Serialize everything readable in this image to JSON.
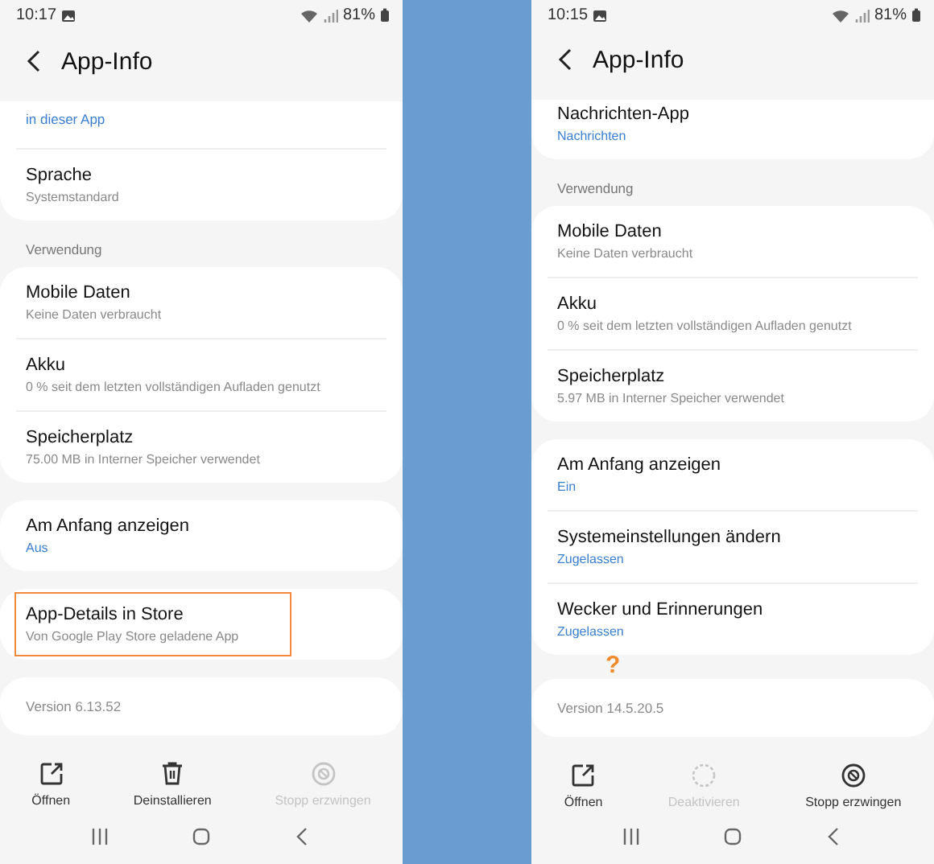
{
  "phones": [
    {
      "status_bar": {
        "time": "10:17",
        "battery": "81%"
      },
      "title": "App-Info",
      "sections": [
        {
          "kind": "card",
          "highlighted": false,
          "cut": true,
          "rows": [
            {
              "subtitle": "in dieser App",
              "accent": true
            },
            {
              "title": "Sprache",
              "subtitle": "Systemstandard",
              "accent": false
            }
          ]
        },
        {
          "kind": "heading",
          "text": "Verwendung"
        },
        {
          "kind": "card",
          "highlighted": false,
          "rows": [
            {
              "title": "Mobile Daten",
              "subtitle": "Keine Daten verbraucht",
              "accent": false
            },
            {
              "title": "Akku",
              "subtitle": "0 % seit dem letzten vollständigen Aufladen genutzt",
              "accent": false
            },
            {
              "title": "Speicherplatz",
              "subtitle": "75.00 MB in Interner Speicher verwendet",
              "accent": false
            }
          ]
        },
        {
          "kind": "card",
          "highlighted": false,
          "rows": [
            {
              "title": "Am Anfang anzeigen",
              "subtitle": "Aus",
              "accent": true
            }
          ]
        },
        {
          "kind": "card",
          "highlighted": true,
          "rows": [
            {
              "title": "App-Details in Store",
              "subtitle": "Von Google Play Store geladene App",
              "accent": false
            }
          ]
        },
        {
          "kind": "card",
          "highlighted": false,
          "rows": [
            {
              "subtitle": "Version 6.13.52",
              "accent": false
            }
          ]
        }
      ],
      "actions": [
        {
          "label": "Öffnen",
          "kind": "open",
          "disabled": false
        },
        {
          "label": "Deinstallieren",
          "kind": "trash",
          "disabled": false
        },
        {
          "label": "Stopp erzwingen",
          "kind": "stop",
          "disabled": true
        }
      ]
    },
    {
      "status_bar": {
        "time": "10:15",
        "battery": "81%"
      },
      "title": "App-Info",
      "sections": [
        {
          "kind": "card",
          "highlighted": false,
          "cut": true,
          "rows": [
            {
              "title": "Nachrichten-App",
              "subtitle": "Nachrichten",
              "accent": true
            }
          ]
        },
        {
          "kind": "heading",
          "text": "Verwendung"
        },
        {
          "kind": "card",
          "highlighted": false,
          "rows": [
            {
              "title": "Mobile Daten",
              "subtitle": "Keine Daten verbraucht",
              "accent": false
            },
            {
              "title": "Akku",
              "subtitle": "0 % seit dem letzten vollständigen Aufladen genutzt",
              "accent": false
            },
            {
              "title": "Speicherplatz",
              "subtitle": "5.97 MB in Interner Speicher verwendet",
              "accent": false
            }
          ]
        },
        {
          "kind": "card",
          "highlighted": false,
          "rows": [
            {
              "title": "Am Anfang anzeigen",
              "subtitle": "Ein",
              "accent": true
            },
            {
              "title": "Systemeinstellungen ändern",
              "subtitle": "Zugelassen",
              "accent": true
            },
            {
              "title": "Wecker und Erinnerungen",
              "subtitle": "Zugelassen",
              "accent": true
            }
          ]
        },
        {
          "kind": "annotation",
          "text": "?"
        },
        {
          "kind": "card",
          "highlighted": false,
          "rows": [
            {
              "subtitle": "Version 14.5.20.5",
              "accent": false
            }
          ]
        }
      ],
      "actions": [
        {
          "label": "Öffnen",
          "kind": "open",
          "disabled": false
        },
        {
          "label": "Deaktivieren",
          "kind": "disable",
          "disabled": true
        },
        {
          "label": "Stopp erzwingen",
          "kind": "stop",
          "disabled": false
        }
      ]
    }
  ]
}
